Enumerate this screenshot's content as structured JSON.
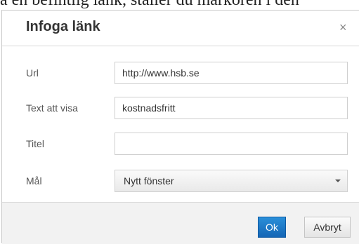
{
  "background": {
    "text": "a en befintlig länk, ställer du markören i den"
  },
  "dialog": {
    "title": "Infoga länk",
    "close_glyph": "×",
    "close_icon": "close-icon",
    "fields": {
      "url": {
        "label": "Url",
        "value": "http://www.hsb.se"
      },
      "text": {
        "label": "Text att visa",
        "value": "kostnadsfritt"
      },
      "title": {
        "label": "Titel",
        "value": ""
      },
      "target": {
        "label": "Mål",
        "selected": "Nytt fönster"
      }
    },
    "buttons": {
      "ok": "Ok",
      "cancel": "Avbryt"
    }
  },
  "colors": {
    "primary_button": "#1a75c6",
    "dialog_background": "#ffffff",
    "footer_background": "#f2f2f2"
  }
}
